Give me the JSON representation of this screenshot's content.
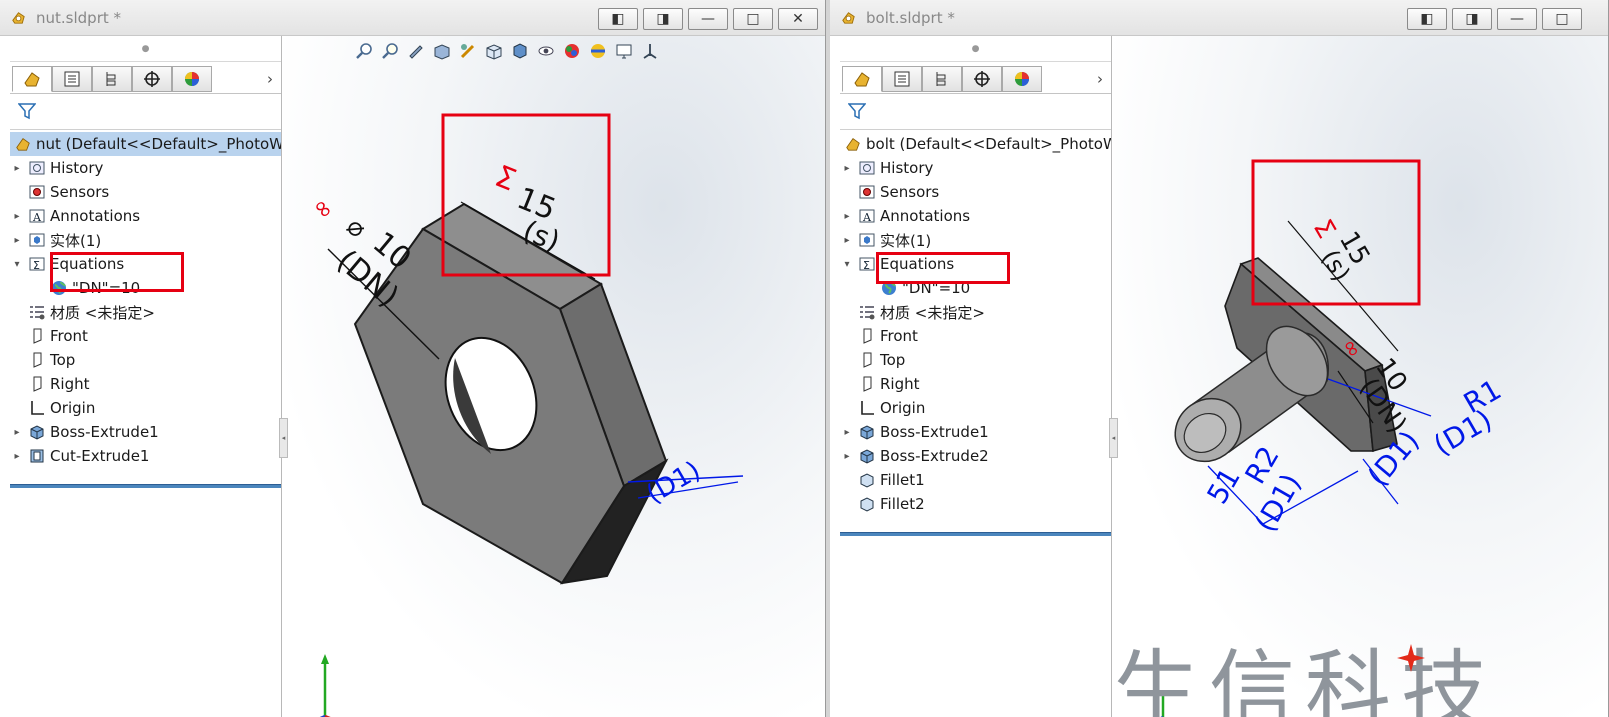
{
  "nut_window": {
    "title": "nut.sldprt *",
    "tree": {
      "root": "nut  (Default<<Default>_PhotoWorks",
      "items": [
        "History",
        "Sensors",
        "Annotations",
        "实体(1)",
        "Equations",
        "\"DN\"=10",
        "材质 <未指定>",
        "Front",
        "Top",
        "Right",
        "Origin",
        "Boss-Extrude1",
        "Cut-Extrude1"
      ]
    },
    "annotations": {
      "sigma": "Σ",
      "dim_s_value": "15",
      "dim_s_name": "(s)",
      "dim_dn_value": "10",
      "dim_dn_name": "(DN)",
      "dim_d1_name": "(D1)",
      "diam_symbol": "⌀"
    }
  },
  "bolt_window": {
    "title": "bolt.sldprt *",
    "tree": {
      "root": "bolt  (Default<<Default>_PhotoWorks",
      "items": [
        "History",
        "Sensors",
        "Annotations",
        "实体(1)",
        "Equations",
        "\"DN\"=10",
        "材质 <未指定>",
        "Front",
        "Top",
        "Right",
        "Origin",
        "Boss-Extrude1",
        "Boss-Extrude2",
        "Fillet1",
        "Fillet2"
      ]
    },
    "annotations": {
      "sigma": "Σ",
      "dim_s_value": "15",
      "dim_s_name": "(s)",
      "dim_dn_value": "10",
      "dim_dn_name": "(DN)",
      "dim_r1": "R1",
      "dim_r1_name": "(D1)",
      "dim_d1_name": "(D1)",
      "dim_r2": "R2",
      "dim_r2_name": "(D1)",
      "dim_51": "51"
    }
  },
  "watermark": {
    "text": "生信科技"
  },
  "colors": {
    "highlight": "#e60012",
    "dimension": "#0018e8",
    "selection": "#b9d3ee",
    "part": "#7a7a7a"
  }
}
